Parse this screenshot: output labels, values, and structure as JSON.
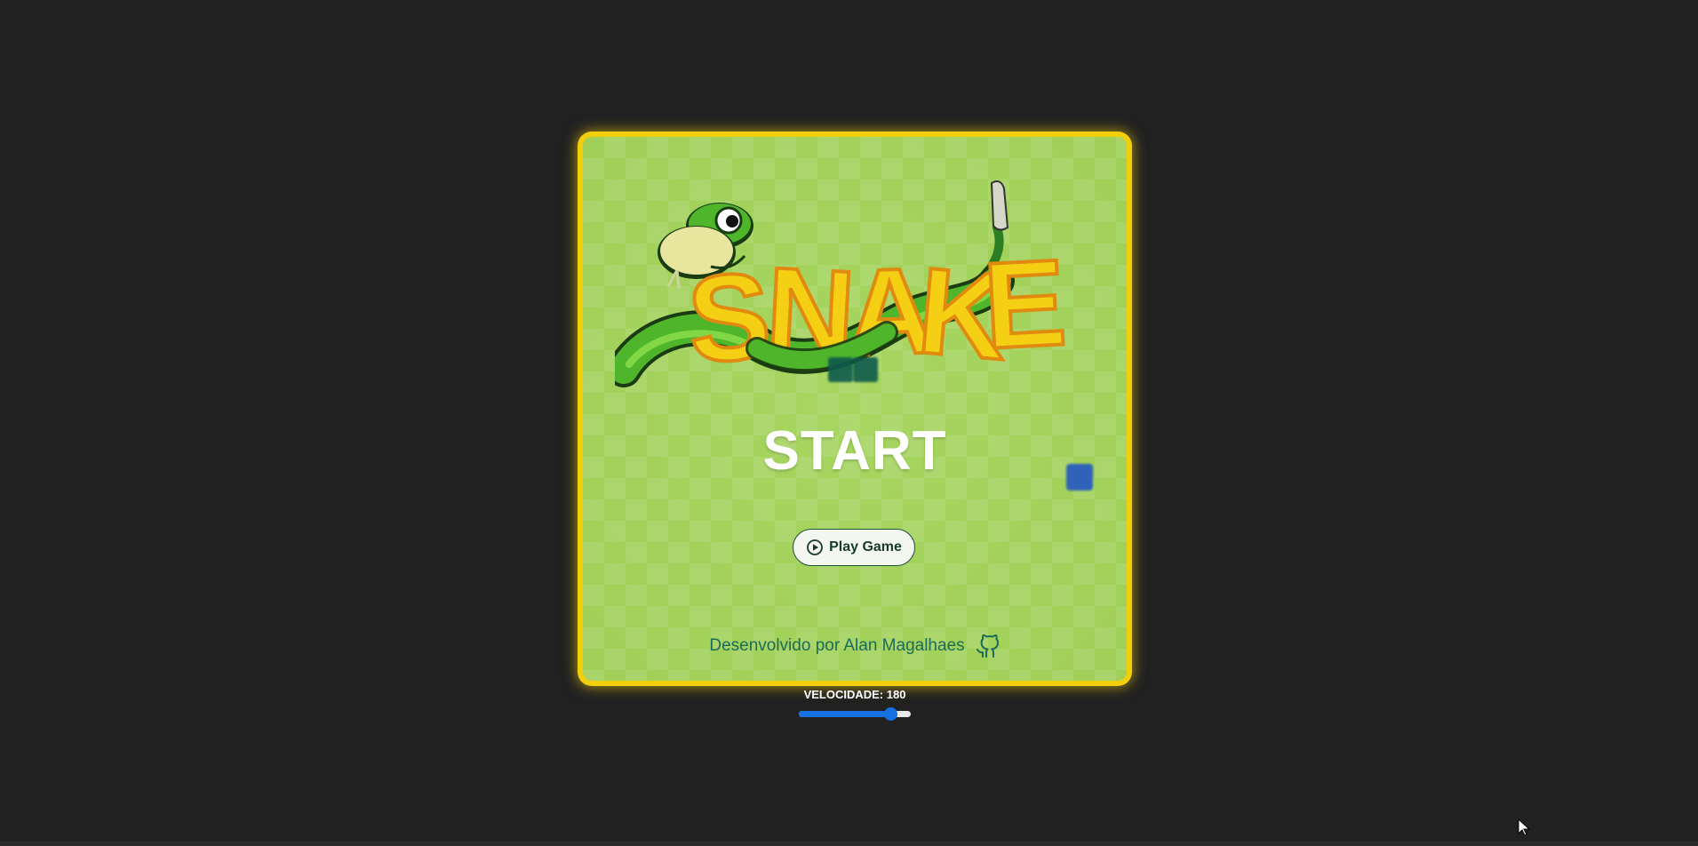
{
  "game": {
    "logo_text": "SNAKE",
    "start_title": "START",
    "play_button_label": "Play Game",
    "credit_text": "Desenvolvido por Alan Magalhaes",
    "colors": {
      "background": "#212121",
      "board": "#a3d45a",
      "board_border": "#f2cf0c",
      "snake": "#0e5a4c",
      "food": "#2f62b8",
      "accent": "#1670e0"
    },
    "icons": [
      "play-circle-icon",
      "github-icon",
      "mouse-cursor-icon"
    ]
  },
  "speed_control": {
    "label": "VELOCIDADE: 180",
    "value": 180,
    "level_fraction": 0.82
  }
}
